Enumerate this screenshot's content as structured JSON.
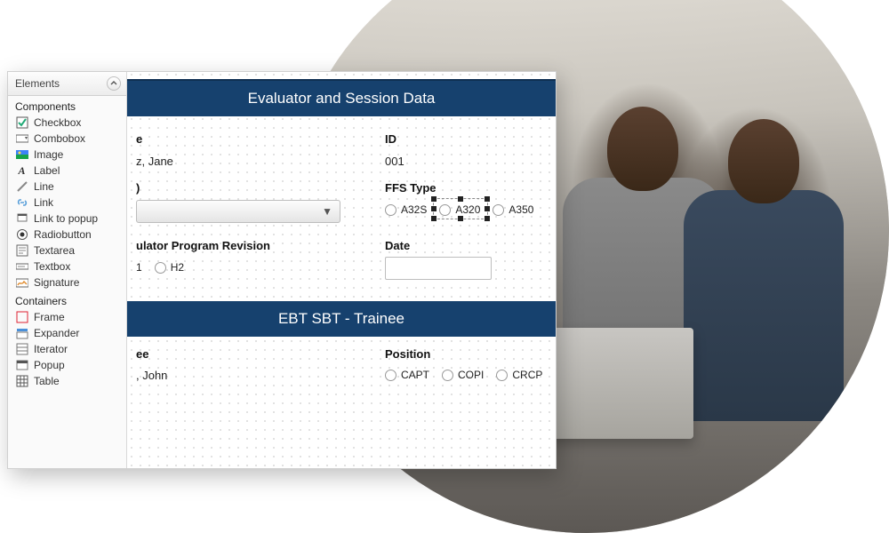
{
  "sidebar": {
    "header": "Elements",
    "groups": [
      {
        "label": "Components",
        "items": [
          {
            "name": "checkbox",
            "label": "Checkbox"
          },
          {
            "name": "combobox",
            "label": "Combobox"
          },
          {
            "name": "image",
            "label": "Image"
          },
          {
            "name": "label",
            "label": "Label"
          },
          {
            "name": "line",
            "label": "Line"
          },
          {
            "name": "link",
            "label": "Link"
          },
          {
            "name": "link-to-popup",
            "label": "Link to popup"
          },
          {
            "name": "radiobutton",
            "label": "Radiobutton"
          },
          {
            "name": "textarea",
            "label": "Textarea"
          },
          {
            "name": "textbox",
            "label": "Textbox"
          },
          {
            "name": "signature",
            "label": "Signature"
          }
        ]
      },
      {
        "label": "Containers",
        "items": [
          {
            "name": "frame",
            "label": "Frame"
          },
          {
            "name": "expander",
            "label": "Expander"
          },
          {
            "name": "iterator",
            "label": "Iterator"
          },
          {
            "name": "popup",
            "label": "Popup"
          },
          {
            "name": "table",
            "label": "Table"
          }
        ]
      }
    ]
  },
  "form": {
    "banner1": "Evaluator and Session Data",
    "banner2": "EBT SBT - Trainee",
    "evaluator_name_label_fragment": "e",
    "evaluator_name_value_fragment": "z, Jane",
    "id_label": "ID",
    "id_value": "001",
    "sim_label_fragment": ")",
    "ffs_type_label": "FFS Type",
    "ffs_options": [
      "A32S",
      "A320",
      "A350"
    ],
    "program_rev_label_fragment": "ulator Program Revision",
    "program_rev_options_fragment": [
      "1",
      "H2"
    ],
    "date_label": "Date",
    "trainee_label_fragment": "ee",
    "trainee_value_fragment": ", John",
    "position_label": "Position",
    "position_options": [
      "CAPT",
      "COPI",
      "CRCP"
    ]
  },
  "colors": {
    "banner_bg": "#16416e",
    "banner_text": "#ffffff"
  }
}
